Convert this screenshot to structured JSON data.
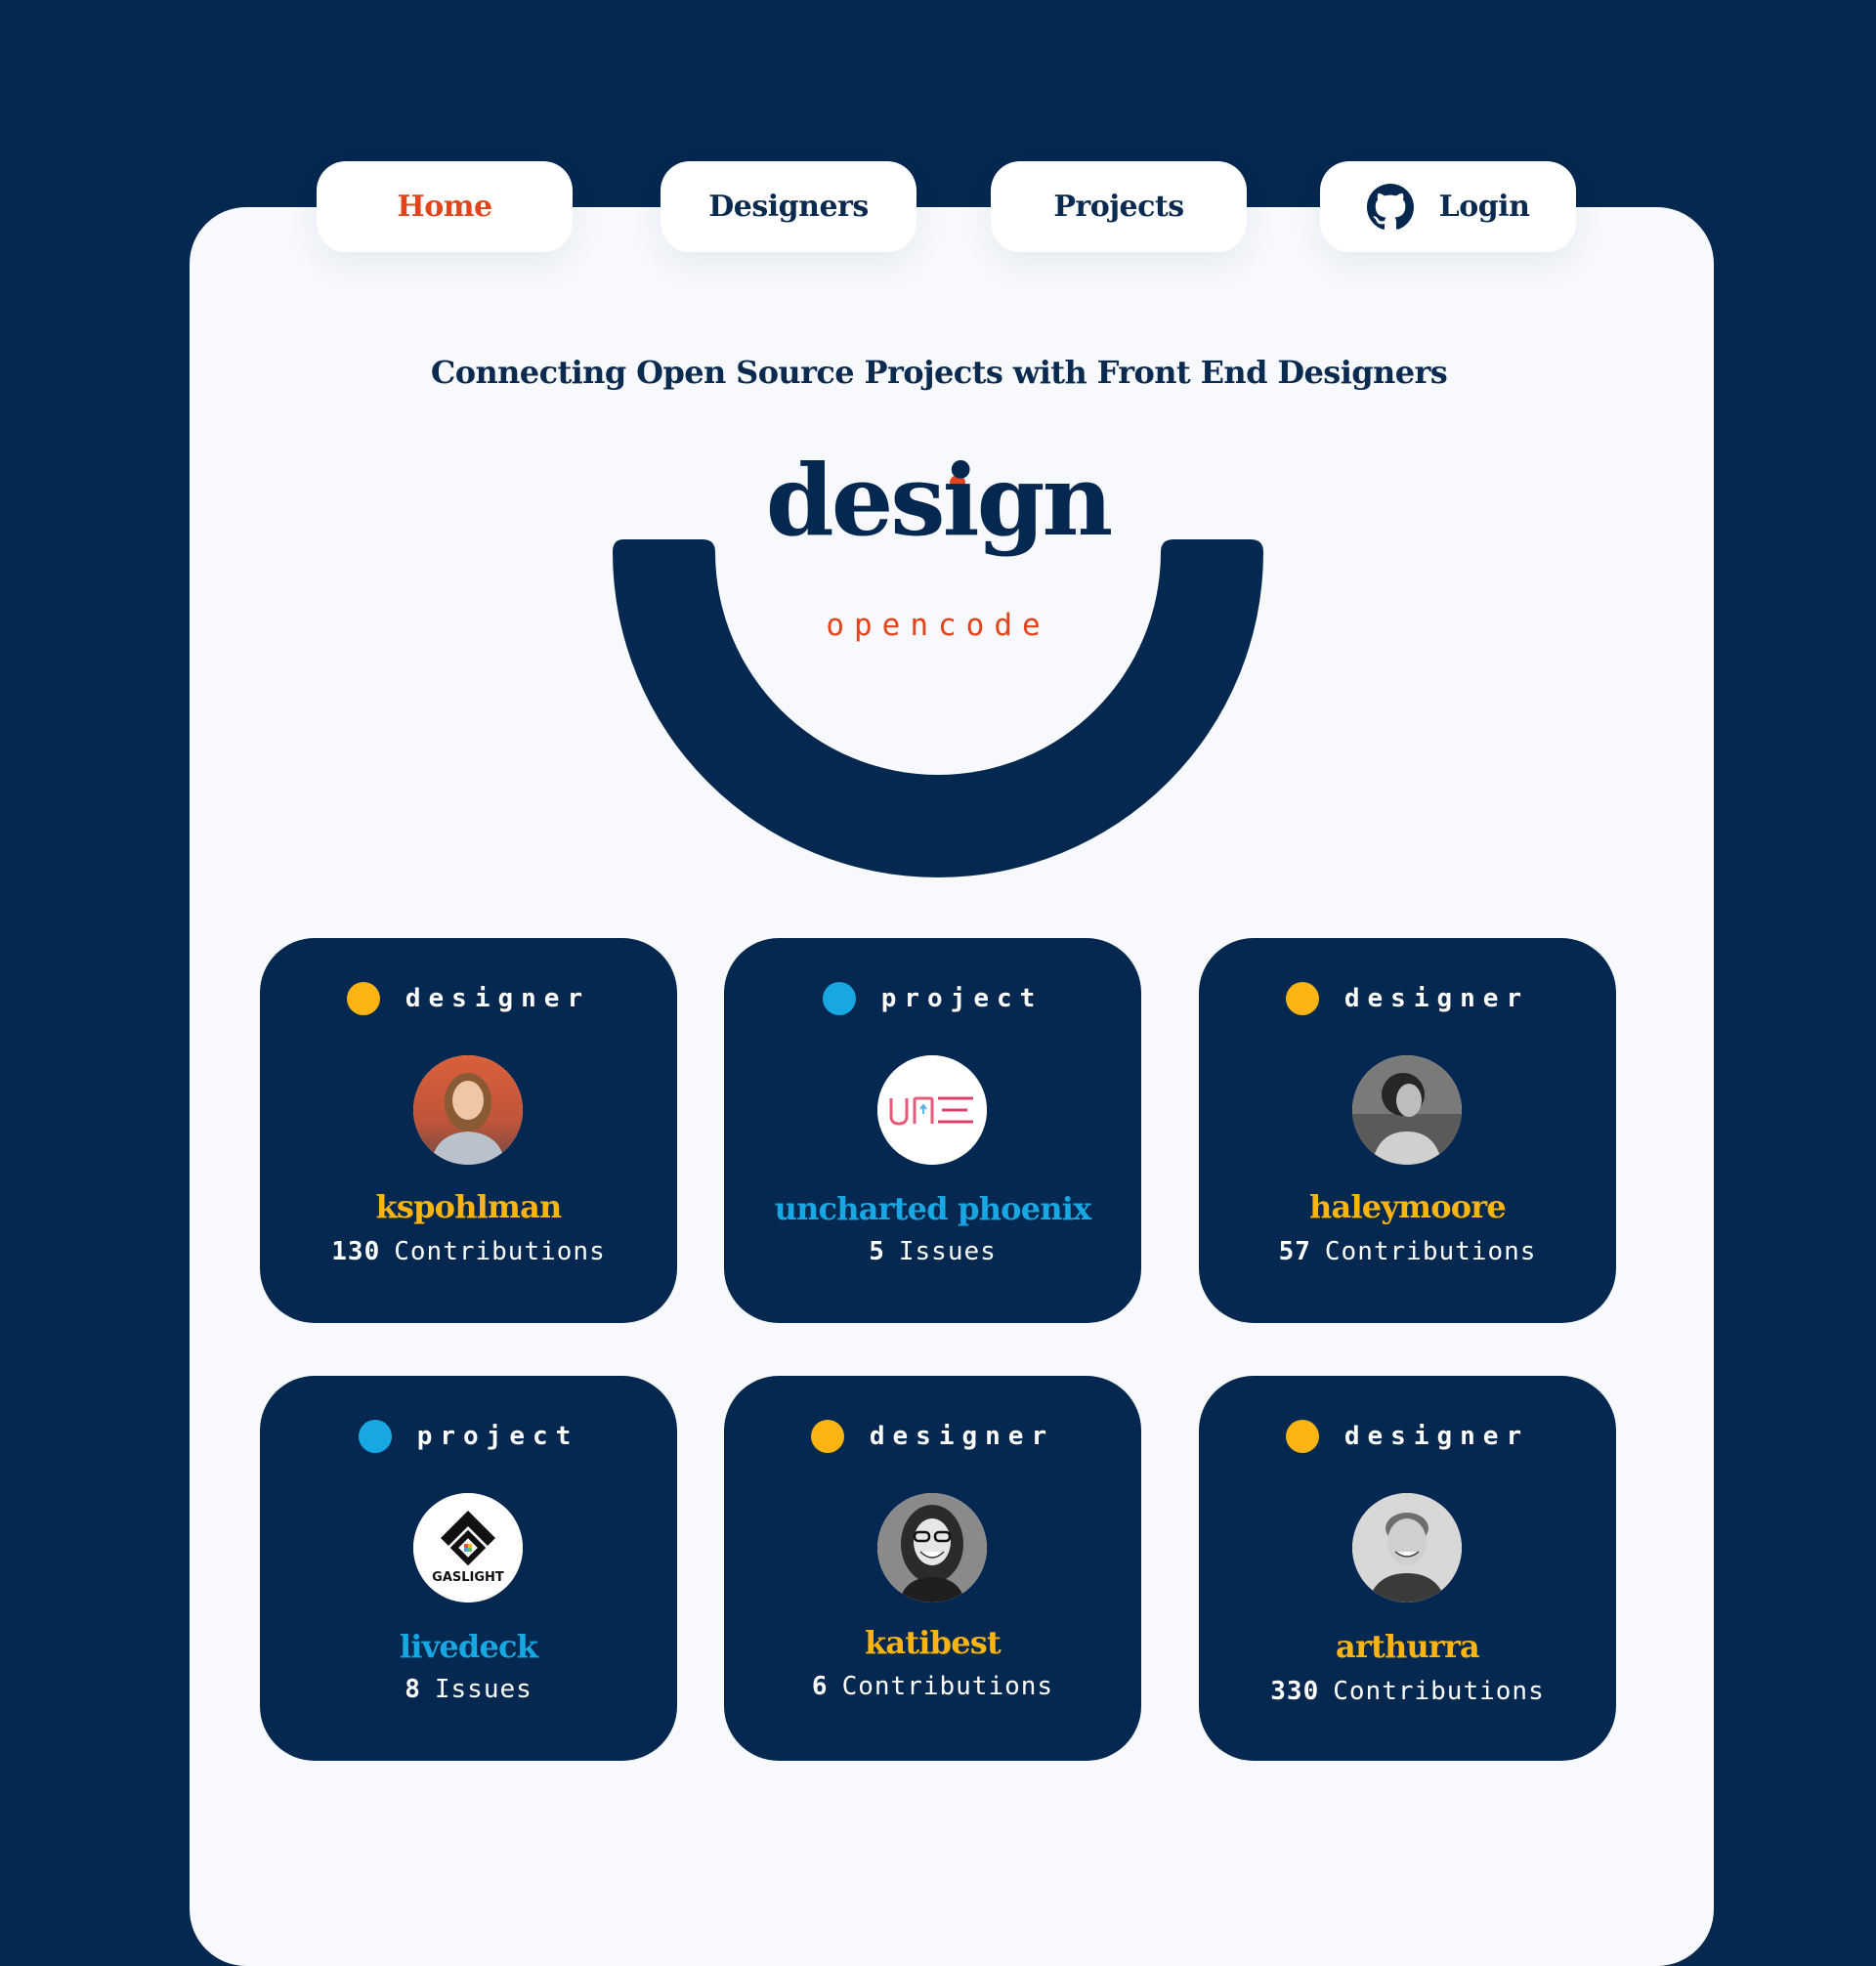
{
  "nav": {
    "items": [
      {
        "label": "Home",
        "active": true
      },
      {
        "label": "Designers",
        "active": false
      },
      {
        "label": "Projects",
        "active": false
      },
      {
        "label": "Login",
        "active": false,
        "icon": "github-icon"
      }
    ]
  },
  "hero": {
    "tagline": "Connecting Open Source Projects with Front End Designers",
    "wordmark": "design",
    "subword": "opencode"
  },
  "colors": {
    "navy": "#04284f",
    "accent": "#e2441c",
    "designer": "#fbb411",
    "project": "#17a8e3",
    "panel": "#f7f9fc"
  },
  "cards": [
    {
      "type": "designer",
      "name": "kspohlman",
      "count": "130",
      "stat_label": "Contributions",
      "avatar": "portrait-avatar"
    },
    {
      "type": "project",
      "name": "uncharted phoenix",
      "count": "5",
      "stat_label": "Issues",
      "avatar": "une-logo"
    },
    {
      "type": "designer",
      "name": "haleymoore",
      "count": "57",
      "stat_label": "Contributions",
      "avatar": "portrait-avatar"
    },
    {
      "type": "project",
      "name": "livedeck",
      "count": "8",
      "stat_label": "Issues",
      "avatar": "gaslight-logo",
      "logo_text": "GASLIGHT"
    },
    {
      "type": "designer",
      "name": "katibest",
      "count": "6",
      "stat_label": "Contributions",
      "avatar": "portrait-avatar"
    },
    {
      "type": "designer",
      "name": "arthurra",
      "count": "330",
      "stat_label": "Contributions",
      "avatar": "portrait-avatar"
    }
  ]
}
